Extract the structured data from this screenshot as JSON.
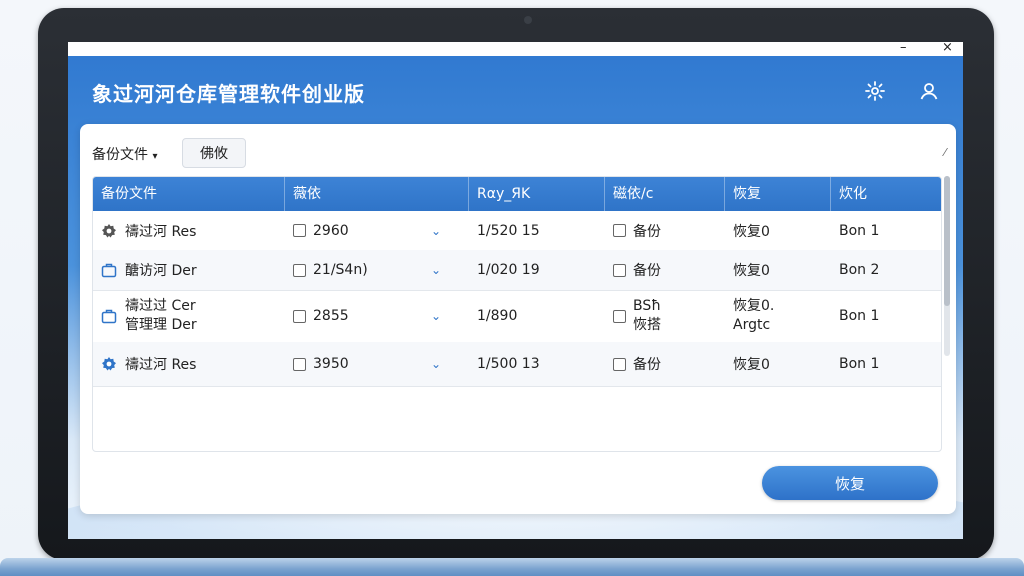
{
  "app": {
    "title": "象过河河仓库管理软件创业版"
  },
  "window_controls": {
    "minimize": "–",
    "close": "×"
  },
  "toolbar": {
    "dropdown_label": "备份文件",
    "dropdown_caret": "▾",
    "button_label": "佛攸"
  },
  "table": {
    "headers": [
      "备份文件",
      "薇依",
      "Rαy_ЯΚ",
      "磁依/c",
      "恢复",
      "炊化"
    ],
    "rows": [
      {
        "icon": "gear-star-icon",
        "name": [
          "禱过河 Res"
        ],
        "value": "2960",
        "date": "1/520 15",
        "type": [
          "备份"
        ],
        "restore": [
          "恢复0"
        ],
        "status": "Bon 1"
      },
      {
        "icon": "briefcase-icon",
        "name": [
          "醣访河 Der"
        ],
        "value": "21/S4n)",
        "date": "1/020 19",
        "type": [
          "备份"
        ],
        "restore": [
          "恢复0"
        ],
        "status": "Bon 2"
      },
      {
        "icon": "briefcase-icon",
        "name": [
          "禱过过 Cer",
          "管理理 Der"
        ],
        "value": "2855",
        "date": "1/890",
        "type": [
          "BSħ",
          "恢搭"
        ],
        "restore": [
          "恢复0.",
          "Argtc"
        ],
        "status": "Bon 1"
      },
      {
        "icon": "gear-icon",
        "name": [
          "禱过河 Res"
        ],
        "value": "3950",
        "date": "1/500 13",
        "type": [
          "备份"
        ],
        "restore": [
          "恢复0"
        ],
        "status": "Bon 1"
      }
    ]
  },
  "footer": {
    "restore_button": "恢复"
  },
  "colors": {
    "accent": "#2f74c8",
    "header_bg": "#3d83d6"
  }
}
